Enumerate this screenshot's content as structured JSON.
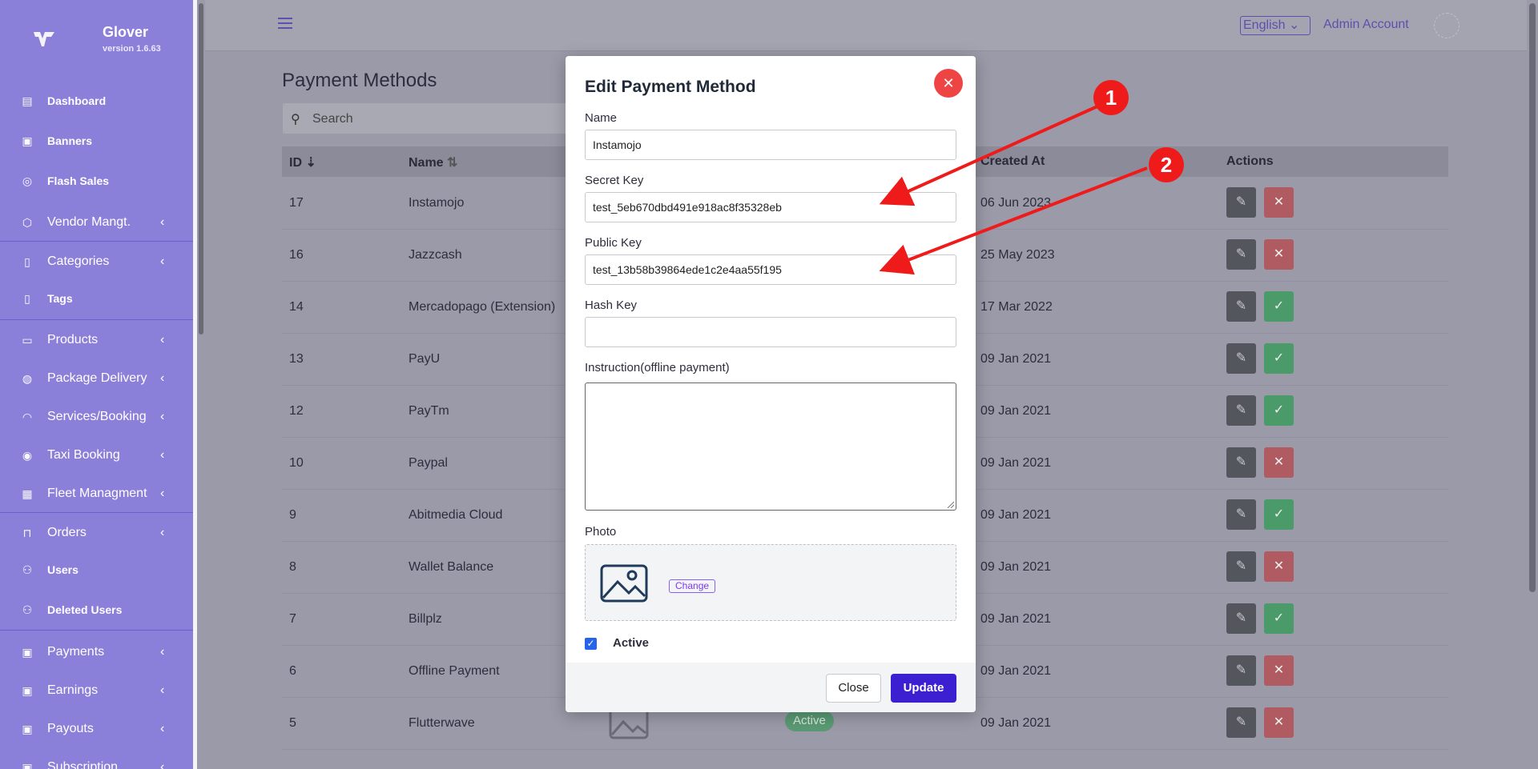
{
  "brand": {
    "name": "Glover",
    "version": "version 1.6.63"
  },
  "sidebar": {
    "items": [
      {
        "label": "Dashboard",
        "icon": "dashboard-icon"
      },
      {
        "label": "Banners",
        "icon": "image-icon"
      },
      {
        "label": "Flash Sales",
        "icon": "flash-icon"
      },
      {
        "label": "Vendor Mangt.",
        "icon": "cube-icon"
      },
      {
        "label": "Categories",
        "icon": "bookmark-icon"
      },
      {
        "label": "Tags",
        "icon": "bookmark-icon"
      },
      {
        "label": "Products",
        "icon": "archive-icon"
      },
      {
        "label": "Package Delivery",
        "icon": "globe-icon"
      },
      {
        "label": "Services/Booking",
        "icon": "rss-icon"
      },
      {
        "label": "Taxi Booking",
        "icon": "broadcast-icon"
      },
      {
        "label": "Fleet Managment",
        "icon": "briefcase-icon"
      },
      {
        "label": "Orders",
        "icon": "bag-icon"
      },
      {
        "label": "Users",
        "icon": "users-icon"
      },
      {
        "label": "Deleted Users",
        "icon": "users-icon"
      },
      {
        "label": "Payments",
        "icon": "cash-icon"
      },
      {
        "label": "Earnings",
        "icon": "cash-icon"
      },
      {
        "label": "Payouts",
        "icon": "cash-icon"
      },
      {
        "label": "Subscription",
        "icon": "cash-icon"
      }
    ]
  },
  "topbar": {
    "language": "English",
    "account": "Admin Account"
  },
  "page": {
    "title": "Payment Methods",
    "search_placeholder": "Search",
    "columns": {
      "id": "ID",
      "name": "Name",
      "created_at": "Created At",
      "actions": "Actions"
    },
    "rows": [
      {
        "id": "17",
        "name": "Instamojo",
        "date": "06 Jun 2023",
        "action": "red"
      },
      {
        "id": "16",
        "name": "Jazzcash",
        "date": "25 May 2023",
        "action": "red"
      },
      {
        "id": "14",
        "name": "Mercadopago (Extension)",
        "date": "17 Mar 2022",
        "action": "green"
      },
      {
        "id": "13",
        "name": "PayU",
        "date": "09 Jan 2021",
        "action": "green"
      },
      {
        "id": "12",
        "name": "PayTm",
        "date": "09 Jan 2021",
        "action": "green"
      },
      {
        "id": "10",
        "name": "Paypal",
        "date": "09 Jan 2021",
        "action": "red"
      },
      {
        "id": "9",
        "name": "Abitmedia Cloud",
        "date": "09 Jan 2021",
        "action": "green"
      },
      {
        "id": "8",
        "name": "Wallet Balance",
        "date": "09 Jan 2021",
        "action": "red"
      },
      {
        "id": "7",
        "name": "Billplz",
        "date": "09 Jan 2021",
        "action": "green"
      },
      {
        "id": "6",
        "name": "Offline Payment",
        "date": "09 Jan 2021",
        "action": "red"
      },
      {
        "id": "5",
        "name": "Flutterwave",
        "date": "09 Jan 2021",
        "action": "red",
        "status": "Active"
      }
    ]
  },
  "modal": {
    "title": "Edit Payment Method",
    "name_label": "Name",
    "name_value": "Instamojo",
    "secret_label": "Secret Key",
    "secret_value": "test_5eb670dbd491e918ac8f35328eb",
    "public_label": "Public Key",
    "public_value": "test_13b58b39864ede1c2e4aa55f195",
    "hash_label": "Hash Key",
    "hash_value": "",
    "instruction_label": "Instruction(offline payment)",
    "photo_label": "Photo",
    "change_label": "Change",
    "active_label": "Active",
    "active_checked": true,
    "close_label": "Close",
    "update_label": "Update"
  },
  "annotations": {
    "marker1": "1",
    "marker2": "2"
  },
  "colors": {
    "sidebar": "#8b80d9",
    "accent": "#3b1fd0",
    "danger": "#ef4444",
    "annotation": "#ef1b1b"
  }
}
